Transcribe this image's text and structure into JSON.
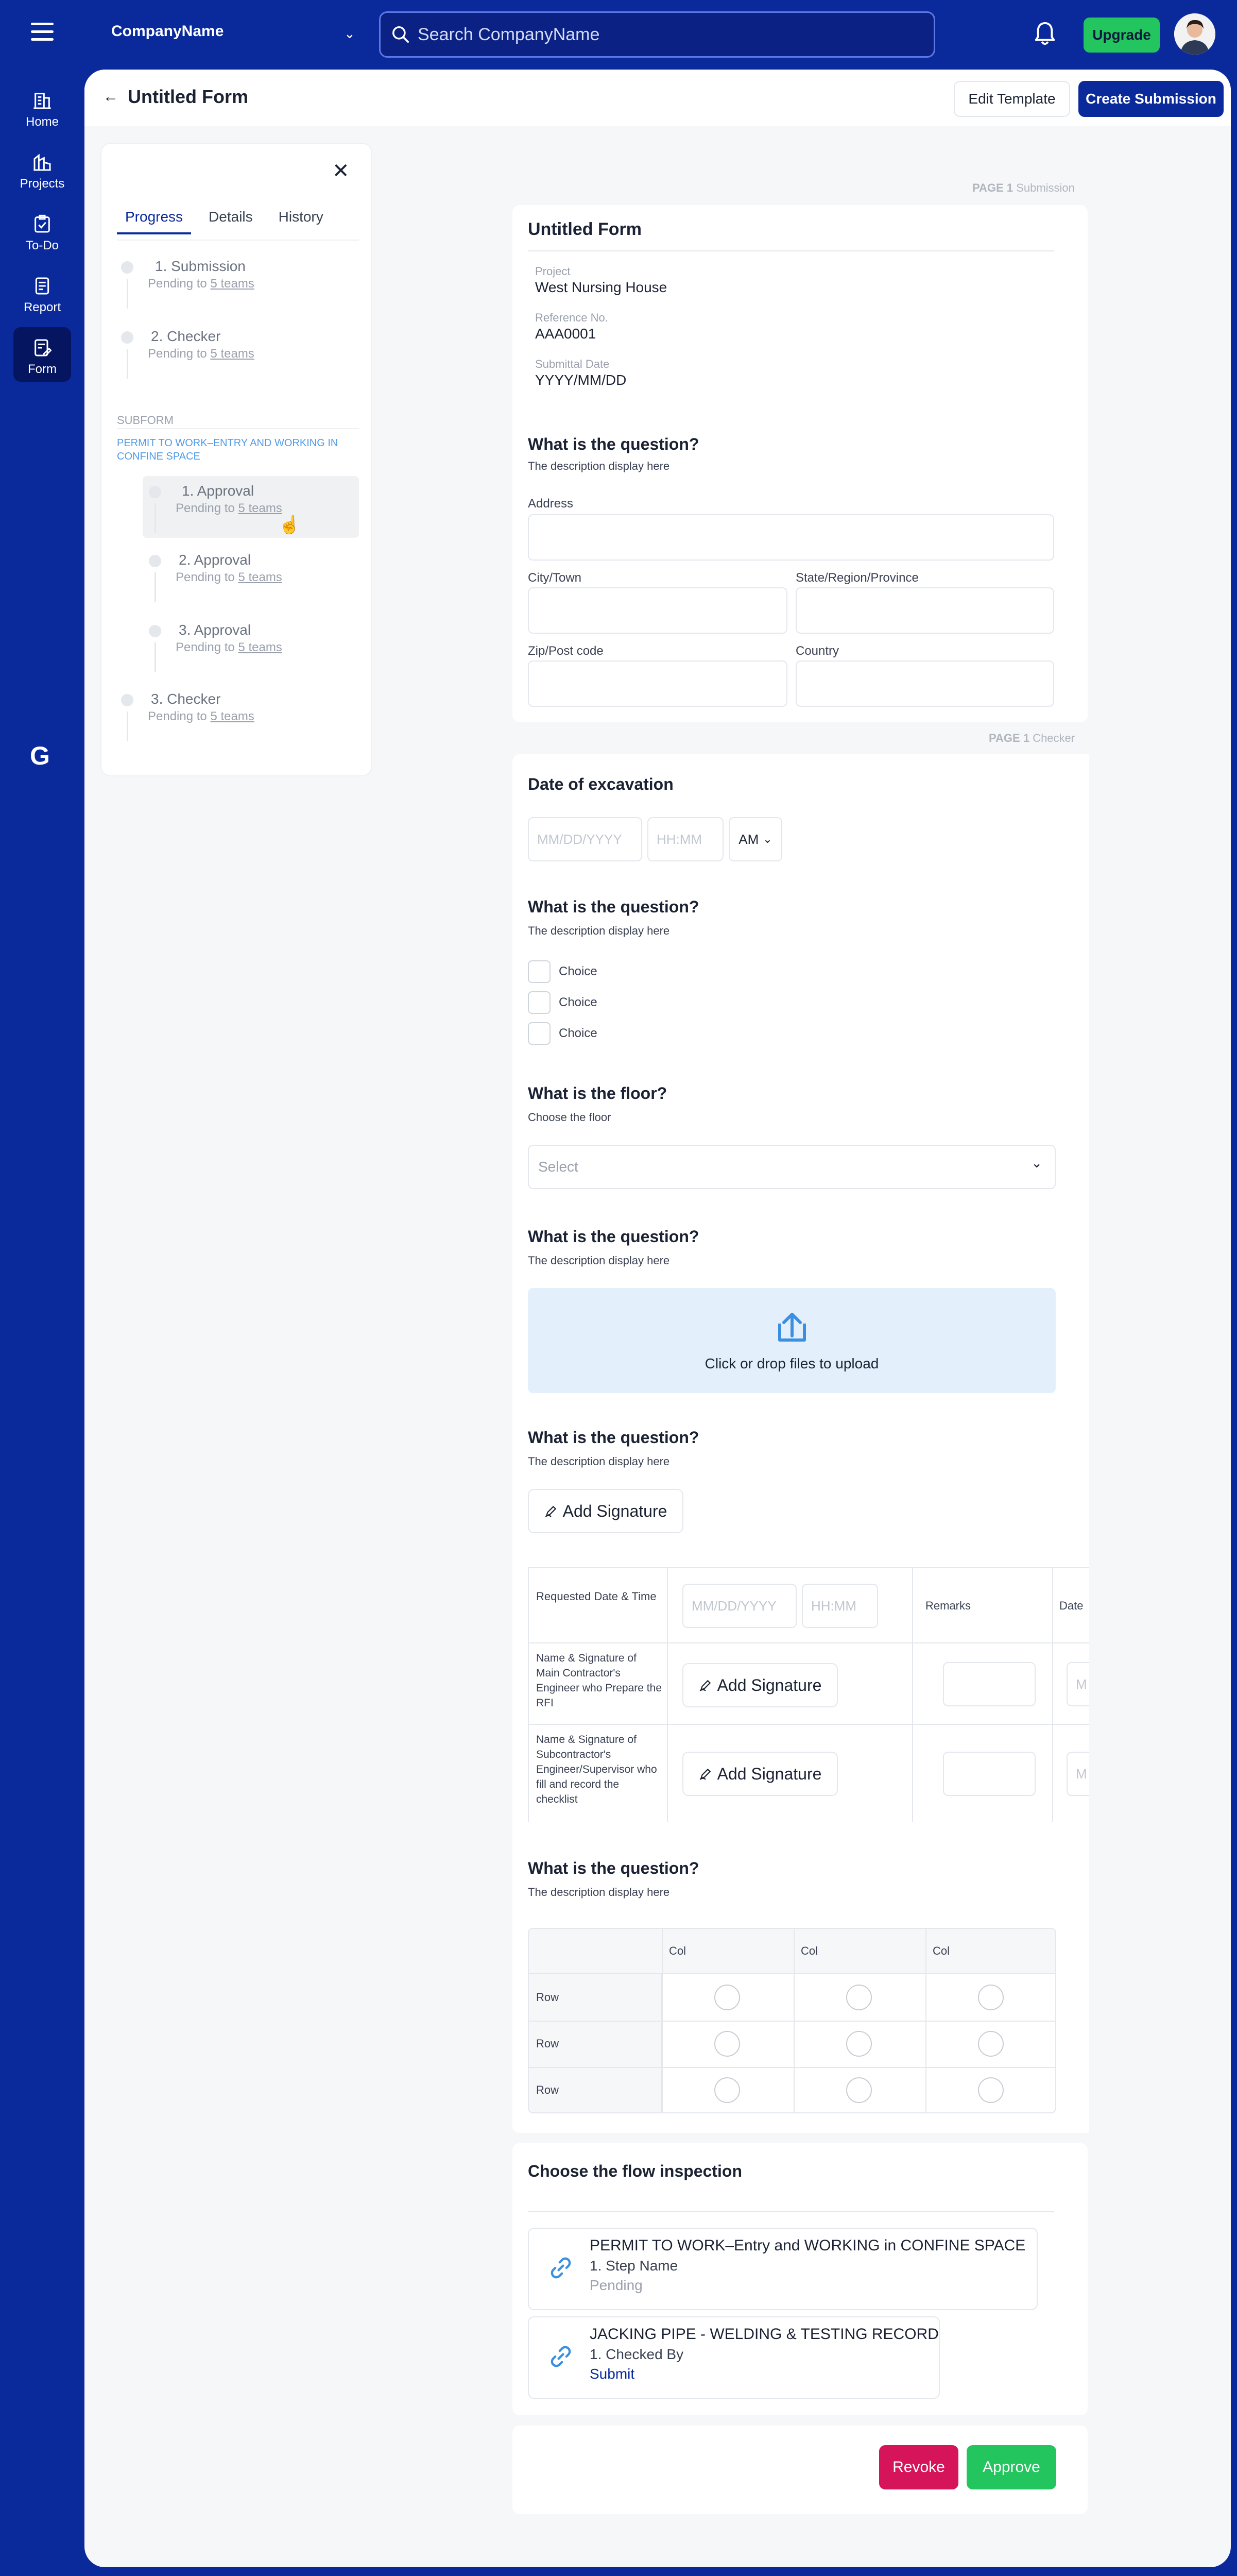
{
  "topbar": {
    "company": "CompanyName",
    "search_placeholder": "Search CompanyName",
    "upgrade_label": "Upgrade"
  },
  "nav": {
    "items": [
      {
        "label": "Home",
        "icon": "home-icon"
      },
      {
        "label": "Projects",
        "icon": "projects-icon"
      },
      {
        "label": "To-Do",
        "icon": "todo-icon"
      },
      {
        "label": "Report",
        "icon": "report-icon"
      },
      {
        "label": "Form",
        "icon": "form-icon",
        "active": true
      }
    ],
    "logo": "G"
  },
  "header": {
    "title": "Untitled Form",
    "edit_label": "Edit Template",
    "create_label": "Create Submission"
  },
  "progress": {
    "tabs": [
      "Progress",
      "Details",
      "History"
    ],
    "steps": [
      {
        "name": "1. Submission",
        "pending": "Pending to ",
        "teams": "5 teams"
      },
      {
        "name": "2. Checker",
        "pending": "Pending to ",
        "teams": "5 teams"
      }
    ],
    "subform_label": "SUBFORM",
    "subform_title": "PERMIT TO WORK–ENTRY AND WORKING IN CONFINE SPACE",
    "substeps": [
      {
        "name": "1. Approval",
        "pending": "Pending to ",
        "teams": "5 teams"
      },
      {
        "name": "2. Approval",
        "pending": "Pending to ",
        "teams": "5 teams"
      },
      {
        "name": "3. Approval",
        "pending": "Pending to ",
        "teams": "5 teams"
      }
    ],
    "final_step": {
      "name": "3. Checker",
      "pending": "Pending to ",
      "teams": "5 teams"
    }
  },
  "form": {
    "page1_tag": "PAGE 1",
    "page1_name": "Submission",
    "title": "Untitled Form",
    "project_label": "Project",
    "project_value": "West Nursing House",
    "ref_label": "Reference No.",
    "ref_value": "AAA0001",
    "date_label": "Submittal Date",
    "date_value": "YYYY/MM/DD",
    "q_address": "What is the question?",
    "q_address_desc": "The description display here",
    "address_label": "Address",
    "city_label": "City/Town",
    "state_label": "State/Region/Province",
    "zip_label": "Zip/Post code",
    "country_label": "Country",
    "page2_tag": "PAGE 1",
    "page2_name": "Checker",
    "excavation_title": "Date of excavation",
    "date_placeholder": "MM/DD/YYYY",
    "time_placeholder": "HH:MM",
    "ampm": "AM",
    "q_choice": "What is the question?",
    "q_choice_desc": "The description display here",
    "choices": [
      "Choice",
      "Choice",
      "Choice"
    ],
    "q_floor": "What is the floor?",
    "q_floor_desc": "Choose the floor",
    "select_placeholder": "Select",
    "q_upload": "What is the question?",
    "q_upload_desc": "The description display here",
    "upload_text": "Click or drop files to upload",
    "q_sig": "What is the question?",
    "q_sig_desc": "The description display here",
    "sig_label": "Add Signature",
    "table": {
      "row1": "Requested Date & Time",
      "row2": "Name & Signature of Main Contractor's Engineer who Prepare the RFI",
      "row3": "Name & Signature of Subcontractor's Engineer/Supervisor who fill and record the checklist",
      "remarks": "Remarks",
      "date_col": "Date",
      "cut_placeholder": "M"
    },
    "q_grid": "What is the question?",
    "q_grid_desc": "The description display here",
    "grid_cols": [
      "Col",
      "Col",
      "Col"
    ],
    "grid_rows": [
      "Row",
      "Row",
      "Row"
    ]
  },
  "flow": {
    "title": "Choose the flow inspection",
    "items": [
      {
        "title": "PERMIT TO WORK–Entry and WORKING in CONFINE SPACE",
        "step": "1. Step Name",
        "status": "Pending",
        "status_color": "#9AA1AD"
      },
      {
        "title": "JACKING PIPE - WELDING & TESTING RECORD",
        "step": "1. Checked By",
        "status": "Submit",
        "status_color": "#0A2A9C"
      }
    ]
  },
  "actions": {
    "revoke": "Revoke",
    "approve": "Approve"
  },
  "colors": {
    "brand": "#0A2A9C",
    "success": "#22C55E",
    "danger": "#D6145A",
    "subform": "#4F9BE8"
  }
}
